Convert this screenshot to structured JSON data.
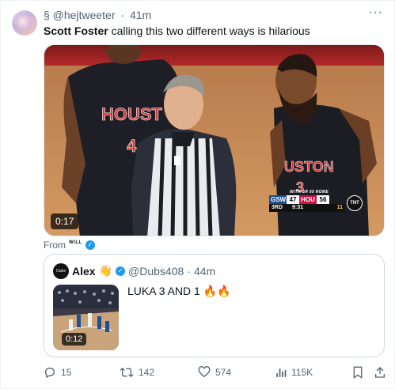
{
  "tweet": {
    "author_handle": "§ @hejtweeter",
    "separator": "·",
    "time": "41m",
    "more_label": "···",
    "text_bold": "Scott Foster",
    "text_rest": " calling this two different ways is hilarious"
  },
  "media": {
    "duration": "0:17",
    "scorebug": {
      "header": "WITH SR 60 ROME",
      "away_team": "GSW",
      "away_score": "47",
      "home_team": "HOU",
      "home_score": "56",
      "period": "3RD",
      "clock": "9:31",
      "shot_clock": "11",
      "network": "TNT",
      "away_color": "#1d4f91",
      "home_color": "#ce1141"
    },
    "jersey_left": "HOUST",
    "jersey_left_number": "4",
    "jersey_right": "USTON",
    "jersey_right_number": "3"
  },
  "from": {
    "label": "From",
    "source": "WILL"
  },
  "quote": {
    "avatar_text": "Dubs",
    "name": "Alex",
    "emoji": "👋",
    "handle": "@Dubs408",
    "separator": "·",
    "time": "44m",
    "text": "LUKA 3 AND 1 🔥🔥",
    "duration": "0:12"
  },
  "actions": {
    "replies": "15",
    "reposts": "142",
    "likes": "574",
    "views": "115K"
  },
  "colors": {
    "text_primary": "#0f1419",
    "text_secondary": "#536471",
    "verified_blue": "#1d9bf0",
    "border": "#cfd9de"
  }
}
